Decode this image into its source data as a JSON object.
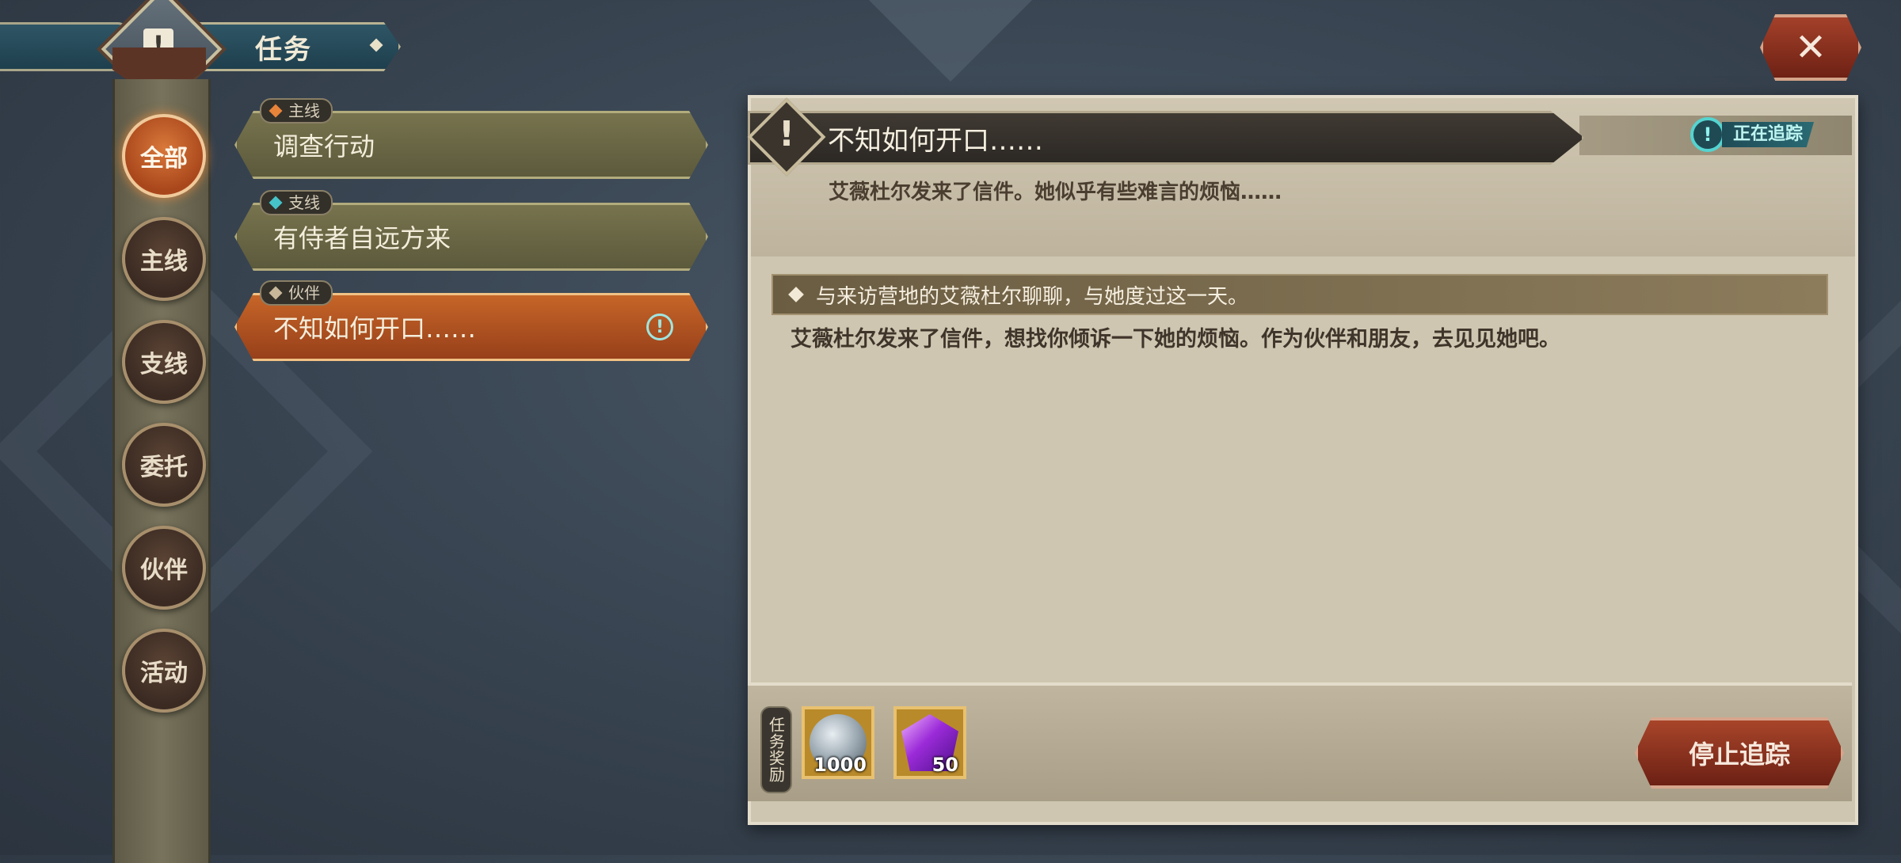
{
  "header": {
    "title": "任务",
    "emblem_icon": "quest-scroll-icon",
    "close_icon": "close-icon"
  },
  "categories": [
    {
      "label": "全部",
      "active": true
    },
    {
      "label": "主线",
      "active": false
    },
    {
      "label": "支线",
      "active": false
    },
    {
      "label": "委托",
      "active": false
    },
    {
      "label": "伙伴",
      "active": false
    },
    {
      "label": "活动",
      "active": false
    }
  ],
  "quests": [
    {
      "tag": "主线",
      "title": "调查行动",
      "tag_color": "#e8833a",
      "selected": false
    },
    {
      "tag": "支线",
      "title": "有侍者自远方来",
      "tag_color": "#46c3c9",
      "selected": false
    },
    {
      "tag": "伙伴",
      "title": "不知如何开口……",
      "tag_color": "#c9b79a",
      "selected": true,
      "tracked": true
    }
  ],
  "detail": {
    "title": "不知如何开口……",
    "tracking_label": "正在追踪",
    "summary": "艾薇杜尔发来了信件。她似乎有些难言的烦恼……",
    "objective": "与来访营地的艾薇杜尔聊聊，与她度过这一天。",
    "description": "艾薇杜尔发来了信件，想找你倾诉一下她的烦恼。作为伙伴和朋友，去见见她吧。"
  },
  "rewards": {
    "label": "任务奖励",
    "items": [
      {
        "icon": "silver-coin-icon",
        "quantity": "1000"
      },
      {
        "icon": "purple-gem-icon",
        "quantity": "50"
      }
    ]
  },
  "actions": {
    "stop_tracking": "停止追踪"
  },
  "colors": {
    "accent_orange": "#c66528",
    "panel": "#cfc6b1",
    "tracking_cyan": "#54d4d0"
  }
}
